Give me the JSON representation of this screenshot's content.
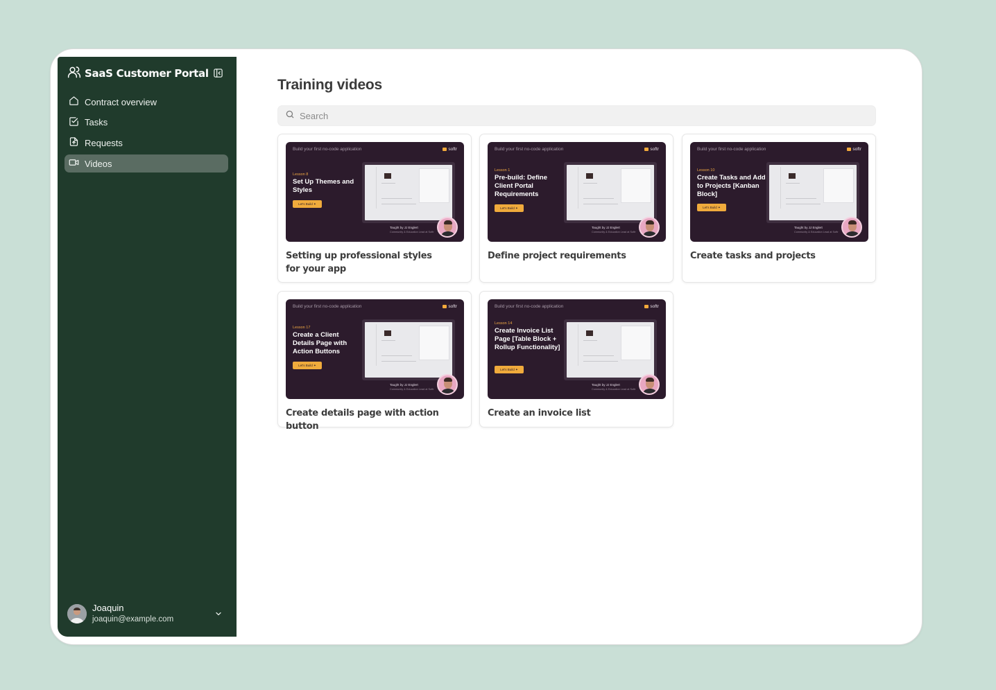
{
  "sidebar": {
    "app_title": "SaaS Customer Portal",
    "nav": [
      {
        "label": "Contract overview",
        "icon": "home-icon",
        "active": false
      },
      {
        "label": "Tasks",
        "icon": "checkbox-icon",
        "active": false
      },
      {
        "label": "Requests",
        "icon": "file-upload-icon",
        "active": false
      },
      {
        "label": "Videos",
        "icon": "video-icon",
        "active": true
      }
    ],
    "user": {
      "name": "Joaquin",
      "email": "joaquin@example.com"
    }
  },
  "main": {
    "title": "Training videos",
    "search_placeholder": "Search",
    "thumb_common": {
      "series": "Build your first no-code application",
      "brand": "softr",
      "cta": "Let's Build ✦",
      "taught_by": "Taught by JJ Englert",
      "taught_role": "Community & Education Lead at Softr"
    },
    "videos": [
      {
        "lesson": "Lesson 8",
        "heading": "Set Up Themes and Styles",
        "title": "Setting up professional styles for your app"
      },
      {
        "lesson": "Lesson 1",
        "heading": "Pre-build: Define Client Portal Requirements",
        "title": "Define project requirements"
      },
      {
        "lesson": "Lesson 10",
        "heading": "Create Tasks and Add to Projects [Kanban Block]",
        "title": "Create tasks and projects"
      },
      {
        "lesson": "Lesson 17",
        "heading": "Create a Client Details Page with Action Buttons",
        "title": "Create details page with action button"
      },
      {
        "lesson": "Lesson 14",
        "heading": "Create Invoice List Page [Table Block + Rollup Functionality]",
        "title": "Create an invoice list"
      }
    ]
  },
  "colors": {
    "page_bg": "#c9dfd6",
    "sidebar_bg": "#203b2c",
    "active_nav_bg": "#5a6c62",
    "thumb_bg": "#2c1b2c",
    "thumb_accent": "#f0ab3c"
  }
}
